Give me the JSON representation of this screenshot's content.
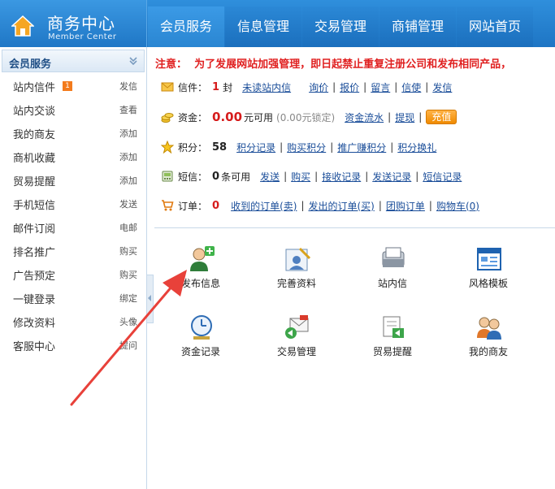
{
  "header": {
    "title": "商务中心",
    "subtitle": "Member Center",
    "nav": [
      {
        "label": "会员服务",
        "active": true
      },
      {
        "label": "信息管理"
      },
      {
        "label": "交易管理"
      },
      {
        "label": "商铺管理"
      },
      {
        "label": "网站首页"
      }
    ]
  },
  "sidebar": {
    "heading": "会员服务",
    "items": [
      {
        "label": "站内信件",
        "badge": "1",
        "action": "发信"
      },
      {
        "label": "站内交谈",
        "action": "查看"
      },
      {
        "label": "我的商友",
        "action": "添加"
      },
      {
        "label": "商机收藏",
        "action": "添加"
      },
      {
        "label": "贸易提醒",
        "action": "添加"
      },
      {
        "label": "手机短信",
        "action": "发送"
      },
      {
        "label": "邮件订阅",
        "action": "电邮"
      },
      {
        "label": "排名推广",
        "action": "购买"
      },
      {
        "label": "广告预定",
        "action": "购买"
      },
      {
        "label": "一键登录",
        "action": "绑定"
      },
      {
        "label": "修改资料",
        "action": "头像"
      },
      {
        "label": "客服中心",
        "action": "提问"
      }
    ]
  },
  "main": {
    "notice_prefix": "注意：",
    "notice_text": "为了发展网站加强管理，即日起禁止重复注册公司和发布相同产品，",
    "mail": {
      "label": "信件：",
      "count": "1",
      "unit": "封",
      "links": [
        "未读站内信",
        "询价",
        "报价",
        "留言",
        "信使",
        "发信"
      ]
    },
    "funds": {
      "label": "资金：",
      "amount": "0.00",
      "unit": "元可用",
      "locked": "(0.00元锁定)",
      "links": [
        "资金流水",
        "提现"
      ],
      "recharge": "充值"
    },
    "points": {
      "label": "积分：",
      "amount": "58",
      "links": [
        "积分记录",
        "购买积分",
        "推广赚积分",
        "积分换礼"
      ]
    },
    "sms": {
      "label": "短信：",
      "amount": "0",
      "unit": "条可用",
      "links": [
        "发送",
        "购买",
        "接收记录",
        "发送记录",
        "短信记录"
      ]
    },
    "orders": {
      "label": "订单：",
      "amount": "0",
      "links": [
        "收到的订单(卖)",
        "发出的订单(买)",
        "团购订单",
        "购物车(0)"
      ]
    },
    "tiles": [
      {
        "label": "发布信息",
        "icon": "user-add-icon"
      },
      {
        "label": "完善资料",
        "icon": "edit-profile-icon"
      },
      {
        "label": "站内信",
        "icon": "message-box-icon"
      },
      {
        "label": "风格模板",
        "icon": "template-window-icon"
      },
      {
        "label": "资金记录",
        "icon": "clock-icon"
      },
      {
        "label": "交易管理",
        "icon": "trade-envelope-icon"
      },
      {
        "label": "贸易提醒",
        "icon": "reminder-icon"
      },
      {
        "label": "我的商友",
        "icon": "friends-icon"
      }
    ]
  },
  "colors": {
    "header_blue": "#1e75c4",
    "notice_red": "#e02020",
    "link_blue": "#1a4d99",
    "annotation_arrow": "#e8413a"
  }
}
